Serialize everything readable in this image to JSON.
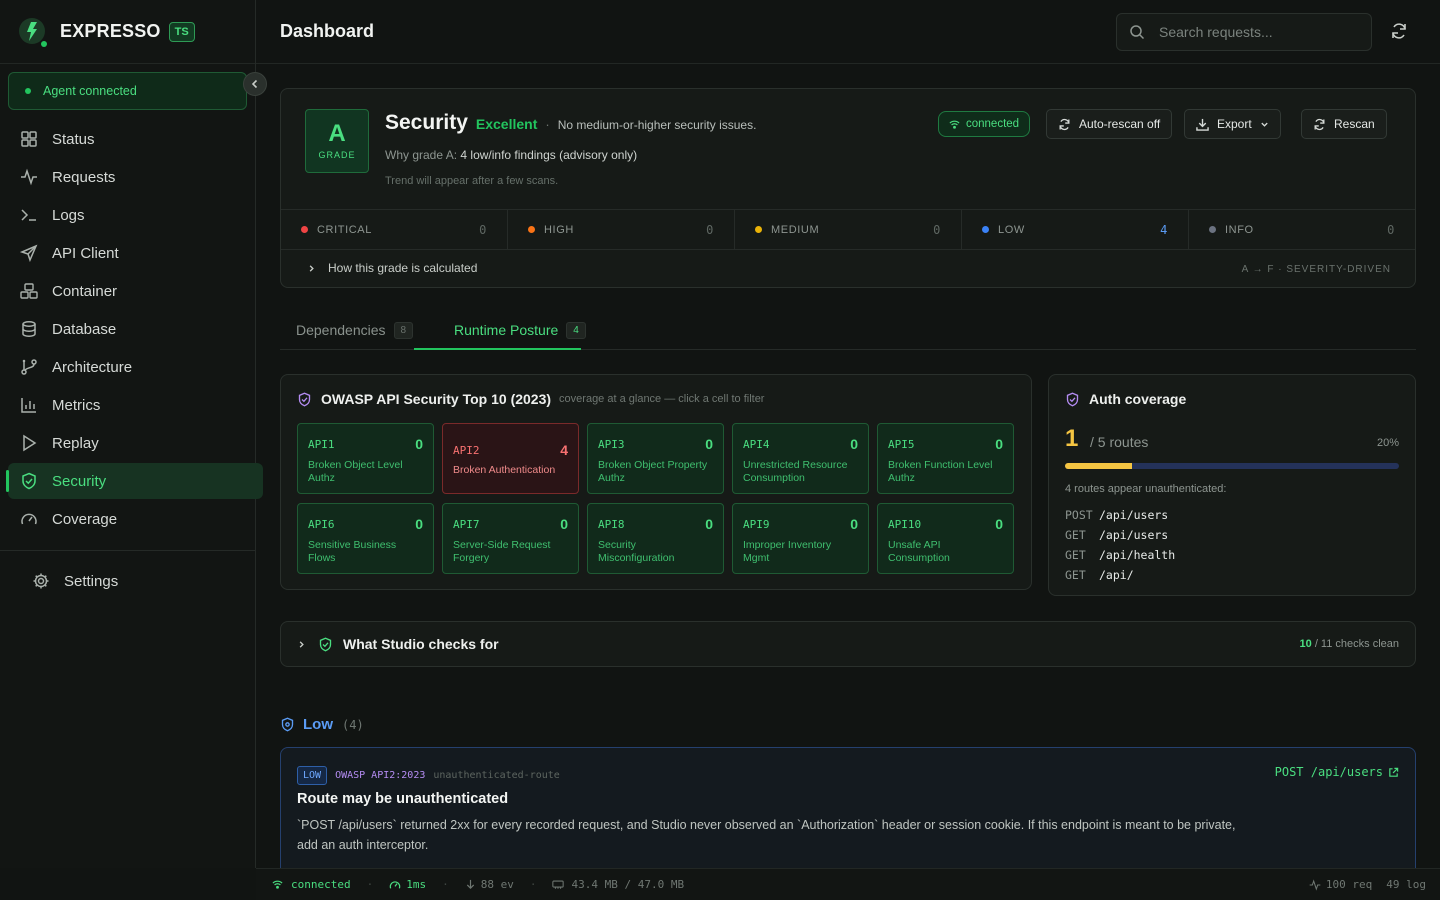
{
  "brand": {
    "name": "EXPRESSO",
    "badge": "TS"
  },
  "agent": {
    "status": "Agent connected"
  },
  "nav": [
    {
      "label": "Status",
      "icon": "grid-icon"
    },
    {
      "label": "Requests",
      "icon": "activity-icon"
    },
    {
      "label": "Logs",
      "icon": "terminal-icon"
    },
    {
      "label": "API Client",
      "icon": "send-icon"
    },
    {
      "label": "Container",
      "icon": "boxes-icon"
    },
    {
      "label": "Database",
      "icon": "database-icon"
    },
    {
      "label": "Architecture",
      "icon": "git-branch-icon"
    },
    {
      "label": "Metrics",
      "icon": "bar-chart-icon"
    },
    {
      "label": "Replay",
      "icon": "play-icon"
    },
    {
      "label": "Security",
      "icon": "shield-check-icon",
      "active": true
    },
    {
      "label": "Coverage",
      "icon": "gauge-icon"
    }
  ],
  "settings": {
    "label": "Settings"
  },
  "header": {
    "title": "Dashboard",
    "search_placeholder": "Search requests..."
  },
  "security": {
    "grade": "A",
    "grade_label": "GRADE",
    "title": "Security",
    "rating": "Excellent",
    "separator": "·",
    "message": "No medium-or-higher security issues.",
    "why_prefix": "Why grade A:",
    "why_detail": "4 low/info findings (advisory only)",
    "trend": "Trend will appear after a few scans.",
    "connection": "connected",
    "buttons": {
      "autorescan": "Auto-rescan off",
      "export": "Export",
      "rescan": "Rescan"
    },
    "severities": [
      {
        "label": "CRITICAL",
        "count": "0",
        "color": "#ef4444"
      },
      {
        "label": "HIGH",
        "count": "0",
        "color": "#f97316"
      },
      {
        "label": "MEDIUM",
        "count": "0",
        "color": "#eab308"
      },
      {
        "label": "LOW",
        "count": "4",
        "color": "#3b82f6",
        "count_color": "#5b9cf5"
      },
      {
        "label": "INFO",
        "count": "0",
        "color": "#6b7280"
      }
    ],
    "how_label": "How this grade is calculated",
    "scale_label": "A → F · SEVERITY-DRIVEN"
  },
  "tabs": [
    {
      "label": "Dependencies",
      "count": "8"
    },
    {
      "label": "Runtime Posture",
      "count": "4",
      "active": true
    }
  ],
  "owasp": {
    "title": "OWASP API Security Top 10 (2023)",
    "subtitle": "coverage at a glance — click a cell to filter",
    "cells": [
      {
        "code": "API1",
        "count": "0",
        "name": "Broken Object Level Authz"
      },
      {
        "code": "API2",
        "count": "4",
        "name": "Broken Authentication",
        "flagged": true
      },
      {
        "code": "API3",
        "count": "0",
        "name": "Broken Object Property Authz"
      },
      {
        "code": "API4",
        "count": "0",
        "name": "Unrestricted Resource Consumption"
      },
      {
        "code": "API5",
        "count": "0",
        "name": "Broken Function Level Authz"
      },
      {
        "code": "API6",
        "count": "0",
        "name": "Sensitive Business Flows"
      },
      {
        "code": "API7",
        "count": "0",
        "name": "Server-Side Request Forgery"
      },
      {
        "code": "API8",
        "count": "0",
        "name": "Security Misconfiguration"
      },
      {
        "code": "API9",
        "count": "0",
        "name": "Improper Inventory Mgmt"
      },
      {
        "code": "API10",
        "count": "0",
        "name": "Unsafe API Consumption"
      }
    ]
  },
  "auth": {
    "title": "Auth coverage",
    "covered": "1",
    "total_label": "/ 5 routes",
    "percent_label": "20%",
    "coverage_fraction": 0.2,
    "unauth_label": "4 routes appear unauthenticated:",
    "routes": [
      {
        "method": "POST",
        "path": "/api/users"
      },
      {
        "method": "GET",
        "path": "/api/users"
      },
      {
        "method": "GET",
        "path": "/api/health"
      },
      {
        "method": "GET",
        "path": "/api/"
      }
    ]
  },
  "checks": {
    "label": "What Studio checks for",
    "clean": "10",
    "total_label": "/ 11 checks clean"
  },
  "low": {
    "label": "Low",
    "count": "(4)",
    "finding": {
      "severity": "LOW",
      "owasp": "OWASP API2:2023",
      "rule": "unauthenticated-route",
      "endpoint": "POST /api/users",
      "title": "Route may be unauthenticated",
      "description": "`POST /api/users` returned 2xx for every recorded request, and Studio never observed an `Authorization` header or session cookie. If this endpoint is meant to be private, add an auth interceptor."
    }
  },
  "statusbar": {
    "connection": "connected",
    "latency": "1ms",
    "events": "88 ev",
    "memory": "43.4 MB / 47.0 MB",
    "requests": "100 req",
    "logs": "49 log"
  },
  "colors": {
    "accent": "#22c55e",
    "low": "#5b9cf5",
    "warning": "#f5c542",
    "danger": "#f87171"
  }
}
